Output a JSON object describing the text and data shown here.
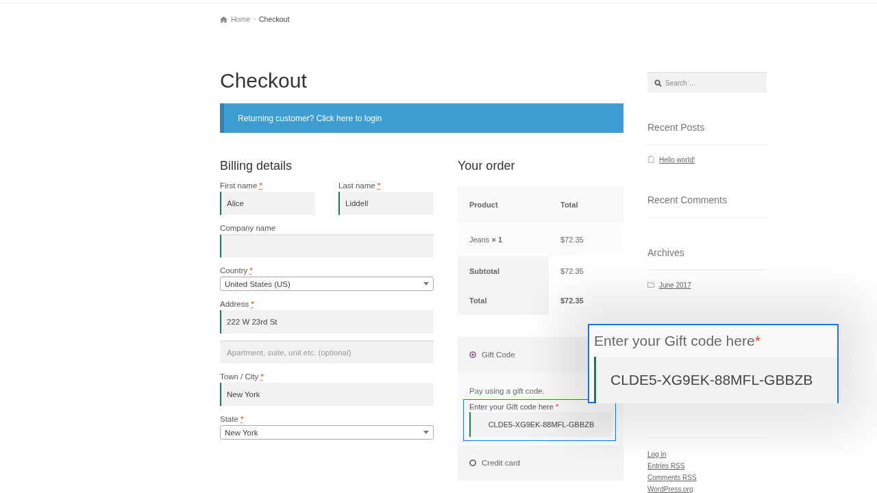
{
  "breadcrumb": [
    {
      "label": "Home"
    },
    {
      "label": "Checkout",
      "separator": "›"
    }
  ],
  "title": "Checkout",
  "notice": "Returning customer? Click here to login",
  "billing": {
    "heading": "Billing details",
    "rows": [
      [
        {
          "label": "First name",
          "required_mark": "*",
          "kind": "text",
          "value": "Alice",
          "validated": true
        },
        {
          "label": "Last name",
          "required_mark": "*",
          "kind": "text",
          "value": "Liddell",
          "validated": true
        }
      ],
      [
        {
          "label": "Company name",
          "kind": "text",
          "validated": true
        }
      ],
      [
        {
          "label": "Country",
          "required_mark": "*",
          "kind": "select",
          "value": "United States (US)"
        }
      ],
      [
        {
          "label": "Address",
          "required_mark": "*",
          "kind": "text",
          "value": "222 W 23rd St",
          "validated": true
        }
      ],
      [
        {
          "kind": "text",
          "placeholder": "Apartment, suite, unit etc. (optional)",
          "validated": false
        }
      ],
      [
        {
          "label": "Town / City",
          "required_mark": "*",
          "kind": "text",
          "value": "New York",
          "validated": true
        }
      ],
      [
        {
          "label": "State",
          "required_mark": "*",
          "kind": "select",
          "value": "New York"
        }
      ]
    ]
  },
  "order": {
    "heading": "Your order",
    "columns": [
      "Product",
      "Total"
    ],
    "items": [
      {
        "name": "Jeans",
        "quantity": "× 1",
        "total": "$72.35"
      }
    ],
    "subtotal": {
      "label": "Subtotal",
      "value": "$72.35"
    },
    "total": {
      "label": "Total",
      "value": "$72.35"
    }
  },
  "payment": {
    "methods": [
      {
        "label": "Gift Code",
        "selected": true,
        "description": "Pay using a gift code.",
        "field": {
          "label": "Enter your Gift code here",
          "required_mark": "*",
          "value": "CLDE5-XG9EK-88MFL-GBBZB"
        }
      },
      {
        "label": "Credit card",
        "selected": false
      }
    ]
  },
  "callout": {
    "label": "Enter your Gift code here",
    "required_mark": "*",
    "value": "CLDE5-XG9EK-88MFL-GBBZB"
  },
  "sidebar": {
    "search": {
      "placeholder": "Search …"
    },
    "widgets": [
      {
        "kind": "posts",
        "title": "Recent Posts",
        "links": [
          {
            "label": "Hello world!"
          }
        ]
      },
      {
        "title": "Recent Comments"
      },
      {
        "kind": "archives",
        "title": "Archives",
        "links": [
          {
            "label": "June 2017"
          }
        ]
      },
      {
        "kind": "meta",
        "links": [
          {
            "label": "Log in"
          },
          {
            "label": "Entries RSS"
          },
          {
            "label": "Comments RSS"
          },
          {
            "label": "WordPress.org"
          }
        ]
      }
    ]
  }
}
